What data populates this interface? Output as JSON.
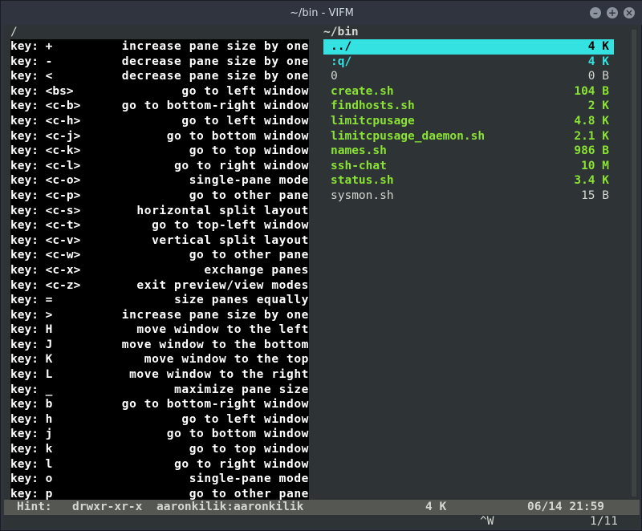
{
  "window": {
    "title": "~/bin - VIFM",
    "buttons": [
      "–",
      "+",
      "×"
    ]
  },
  "left_pane": {
    "header": "/",
    "help_lines": [
      {
        "key": "key: +",
        "desc": "increase pane size by one"
      },
      {
        "key": "key: -",
        "desc": "decrease pane size by one"
      },
      {
        "key": "key: <",
        "desc": "decrease pane size by one"
      },
      {
        "key": "key: <bs>",
        "desc": "go to left window"
      },
      {
        "key": "key: <c-b>",
        "desc": "go to bottom-right window"
      },
      {
        "key": "key: <c-h>",
        "desc": "go to left window"
      },
      {
        "key": "key: <c-j>",
        "desc": "go to bottom window"
      },
      {
        "key": "key: <c-k>",
        "desc": "go to top window"
      },
      {
        "key": "key: <c-l>",
        "desc": "go to right window"
      },
      {
        "key": "key: <c-o>",
        "desc": "single-pane mode"
      },
      {
        "key": "key: <c-p>",
        "desc": "go to other pane"
      },
      {
        "key": "key: <c-s>",
        "desc": "horizontal split layout"
      },
      {
        "key": "key: <c-t>",
        "desc": "go to top-left window"
      },
      {
        "key": "key: <c-v>",
        "desc": "vertical split layout"
      },
      {
        "key": "key: <c-w>",
        "desc": "go to other pane"
      },
      {
        "key": "key: <c-x>",
        "desc": "exchange panes"
      },
      {
        "key": "key: <c-z>",
        "desc": "exit preview/view modes"
      },
      {
        "key": "key: =",
        "desc": "size panes equally"
      },
      {
        "key": "key: >",
        "desc": "increase pane size by one"
      },
      {
        "key": "key: H",
        "desc": "move window to the left"
      },
      {
        "key": "key: J",
        "desc": "move window to the bottom"
      },
      {
        "key": "key: K",
        "desc": "move window to the top"
      },
      {
        "key": "key: L",
        "desc": "move window to the right"
      },
      {
        "key": "key: _",
        "desc": "maximize pane size"
      },
      {
        "key": "key: b",
        "desc": "go to bottom-right window"
      },
      {
        "key": "key: h",
        "desc": "go to left window"
      },
      {
        "key": "key: j",
        "desc": "go to bottom window"
      },
      {
        "key": "key: k",
        "desc": "go to top window"
      },
      {
        "key": "key: l",
        "desc": "go to right window"
      },
      {
        "key": "key: o",
        "desc": "single-pane mode"
      },
      {
        "key": "key: p",
        "desc": "go to other pane"
      }
    ]
  },
  "right_pane": {
    "header": "~/bin",
    "files": [
      {
        "name": "../",
        "size": "4 K",
        "kind": "dir",
        "selected": true
      },
      {
        "name": ":q/",
        "size": "4 K",
        "kind": "dir",
        "selected": false
      },
      {
        "name": "0",
        "size": "0 B",
        "kind": "plain",
        "selected": false
      },
      {
        "name": "create.sh",
        "size": "104 B",
        "kind": "exec",
        "selected": false
      },
      {
        "name": "findhosts.sh",
        "size": "2 K",
        "kind": "exec",
        "selected": false
      },
      {
        "name": "limitcpusage",
        "size": "4.8 K",
        "kind": "exec",
        "selected": false
      },
      {
        "name": "limitcpusage_daemon.sh",
        "size": "2.1 K",
        "kind": "exec",
        "selected": false
      },
      {
        "name": "names.sh",
        "size": "986 B",
        "kind": "exec",
        "selected": false
      },
      {
        "name": "ssh-chat",
        "size": "10 M",
        "kind": "exec",
        "selected": false
      },
      {
        "name": "status.sh",
        "size": "3.4 K",
        "kind": "exec",
        "selected": false
      },
      {
        "name": "sysmon.sh",
        "size": "15 B",
        "kind": "plain",
        "selected": false
      }
    ]
  },
  "status_bar": {
    "hint": "Hint:",
    "permissions": "drwxr-xr-x",
    "owner": "aaronkilik:aaronkilik",
    "size": "4 K",
    "datetime": "06/14 21:59"
  },
  "command_line": {
    "keys": "^W",
    "position": "1/11"
  },
  "colors": {
    "selection": "#34e2e2",
    "directory": "#34e2e2",
    "executable": "#8ae234",
    "status_bar": "#555753"
  }
}
